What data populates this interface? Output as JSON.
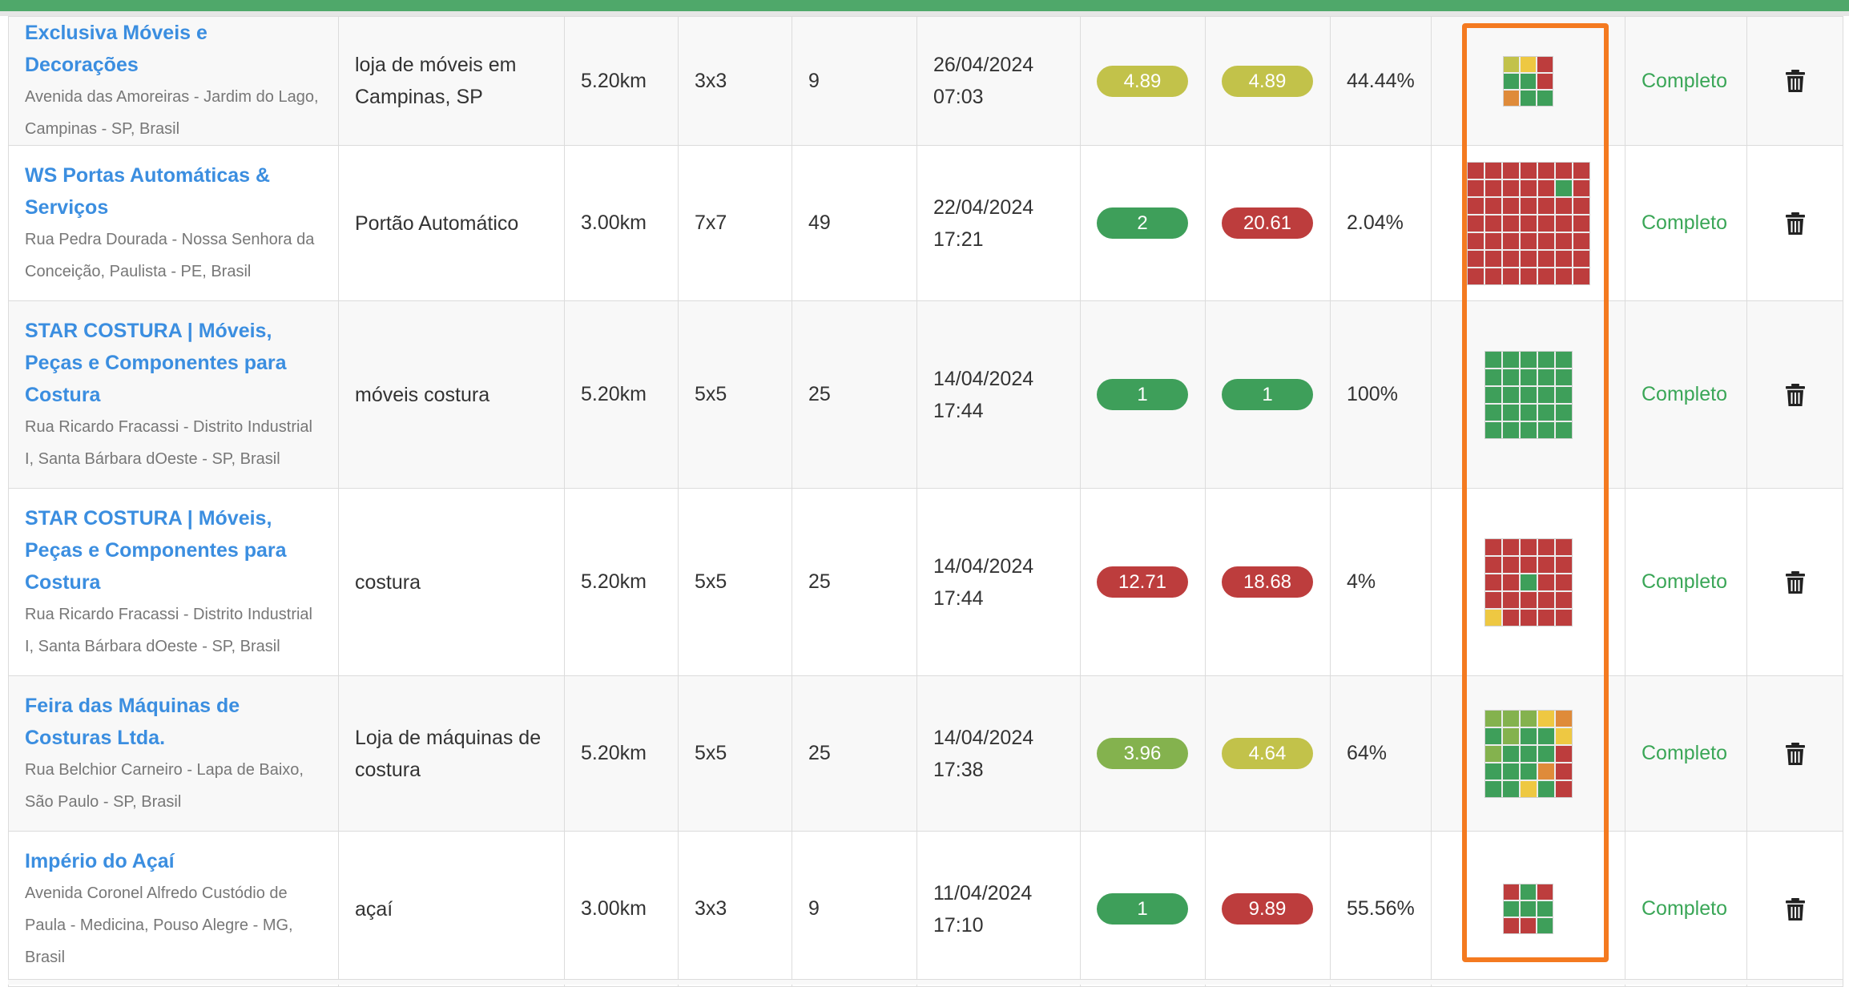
{
  "colors": {
    "green": "#3e9f5a",
    "light_green": "#84b24e",
    "yellow_green": "#c2c24a",
    "yellow": "#eec842",
    "orange": "#df8b3a",
    "red": "#bd3d3d",
    "highlight": "#f47a20",
    "link": "#3b8ee0",
    "status": "#3aa657",
    "header_bar": "#4fa86a"
  },
  "grid_color_legend": {
    "g": "green",
    "l": "light_green",
    "w": "yellow_green",
    "y": "yellow",
    "o": "orange",
    "r": "red"
  },
  "rows": [
    {
      "name": "Exclusiva Móveis e Decorações",
      "address": "Avenida das Amoreiras - Jardim do Lago, Campinas - SP, Brasil",
      "keyword": "loja de móveis em Campinas, SP",
      "radius": "5.20km",
      "grid": "3x3",
      "points": "9",
      "date": "26/04/2024",
      "time": "07:03",
      "avg_rank": "4.89",
      "avg_rank_color": "yellow_green",
      "atrp": "4.89",
      "atrp_color": "yellow_green",
      "solv": "44.44%",
      "grid_size": 3,
      "grid_cells": [
        "w",
        "y",
        "r",
        "g",
        "g",
        "r",
        "o",
        "g",
        "g"
      ],
      "status": "Completo",
      "action_icon": "trash-icon"
    },
    {
      "name": "WS Portas Automáticas & Serviços",
      "address": "Rua Pedra Dourada - Nossa Senhora da Conceição, Paulista - PE, Brasil",
      "keyword": "Portão Automático",
      "radius": "3.00km",
      "grid": "7x7",
      "points": "49",
      "date": "22/04/2024",
      "time": "17:21",
      "avg_rank": "2",
      "avg_rank_color": "green",
      "atrp": "20.61",
      "atrp_color": "red",
      "solv": "2.04%",
      "grid_size": 7,
      "grid_cells": [
        "r",
        "r",
        "r",
        "r",
        "r",
        "r",
        "r",
        "r",
        "r",
        "r",
        "r",
        "r",
        "g",
        "r",
        "r",
        "r",
        "r",
        "r",
        "r",
        "r",
        "r",
        "r",
        "r",
        "r",
        "r",
        "r",
        "r",
        "r",
        "r",
        "r",
        "r",
        "r",
        "r",
        "r",
        "r",
        "r",
        "r",
        "r",
        "r",
        "r",
        "r",
        "r",
        "r",
        "r",
        "r",
        "r",
        "r",
        "r",
        "r"
      ],
      "status": "Completo",
      "action_icon": "trash-icon"
    },
    {
      "name": "STAR COSTURA | Móveis, Peças e Componentes para Costura",
      "address": "Rua Ricardo Fracassi - Distrito Industrial I, Santa Bárbara dOeste - SP, Brasil",
      "keyword": "móveis costura",
      "radius": "5.20km",
      "grid": "5x5",
      "points": "25",
      "date": "14/04/2024",
      "time": "17:44",
      "avg_rank": "1",
      "avg_rank_color": "green",
      "atrp": "1",
      "atrp_color": "green",
      "solv": "100%",
      "grid_size": 5,
      "grid_cells": [
        "g",
        "g",
        "g",
        "g",
        "g",
        "g",
        "g",
        "g",
        "g",
        "g",
        "g",
        "g",
        "g",
        "g",
        "g",
        "g",
        "g",
        "g",
        "g",
        "g",
        "g",
        "g",
        "g",
        "g",
        "g"
      ],
      "status": "Completo",
      "action_icon": "trash-icon"
    },
    {
      "name": "STAR COSTURA | Móveis, Peças e Componentes para Costura",
      "address": "Rua Ricardo Fracassi - Distrito Industrial I, Santa Bárbara dOeste - SP, Brasil",
      "keyword": "costura",
      "radius": "5.20km",
      "grid": "5x5",
      "points": "25",
      "date": "14/04/2024",
      "time": "17:44",
      "avg_rank": "12.71",
      "avg_rank_color": "red",
      "atrp": "18.68",
      "atrp_color": "red",
      "solv": "4%",
      "grid_size": 5,
      "grid_cells": [
        "r",
        "r",
        "r",
        "r",
        "r",
        "r",
        "r",
        "r",
        "r",
        "r",
        "r",
        "r",
        "g",
        "r",
        "r",
        "r",
        "r",
        "r",
        "r",
        "r",
        "y",
        "r",
        "r",
        "r",
        "r"
      ],
      "status": "Completo",
      "action_icon": "trash-icon"
    },
    {
      "name": "Feira das Máquinas de Costuras Ltda.",
      "address": "Rua Belchior Carneiro - Lapa de Baixo, São Paulo - SP, Brasil",
      "keyword": "Loja de máquinas de costura",
      "radius": "5.20km",
      "grid": "5x5",
      "points": "25",
      "date": "14/04/2024",
      "time": "17:38",
      "avg_rank": "3.96",
      "avg_rank_color": "light_green",
      "atrp": "4.64",
      "atrp_color": "yellow_green",
      "solv": "64%",
      "grid_size": 5,
      "grid_cells": [
        "l",
        "l",
        "l",
        "y",
        "o",
        "g",
        "l",
        "g",
        "g",
        "y",
        "l",
        "g",
        "g",
        "g",
        "r",
        "g",
        "g",
        "g",
        "o",
        "r",
        "g",
        "g",
        "y",
        "g",
        "r"
      ],
      "status": "Completo",
      "action_icon": "trash-icon"
    },
    {
      "name": "Império do Açaí",
      "address": "Avenida Coronel Alfredo Custódio de Paula - Medicina, Pouso Alegre - MG, Brasil",
      "keyword": "açaí",
      "radius": "3.00km",
      "grid": "3x3",
      "points": "9",
      "date": "11/04/2024",
      "time": "17:10",
      "avg_rank": "1",
      "avg_rank_color": "green",
      "atrp": "9.89",
      "atrp_color": "red",
      "solv": "55.56%",
      "grid_size": 3,
      "grid_cells": [
        "r",
        "g",
        "r",
        "g",
        "g",
        "g",
        "r",
        "r",
        "g"
      ],
      "status": "Completo",
      "action_icon": "trash-icon"
    }
  ]
}
